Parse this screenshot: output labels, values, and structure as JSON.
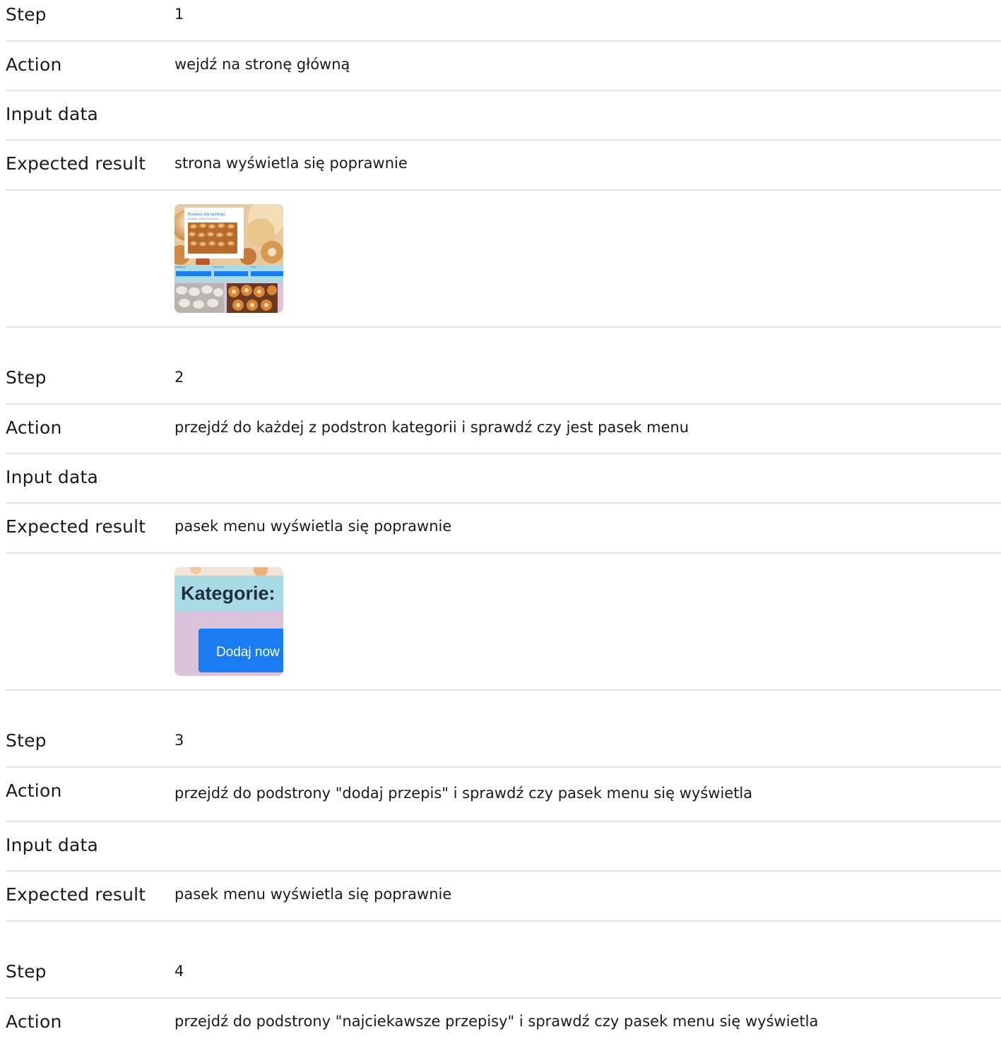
{
  "steps": [
    {
      "step_label": "Step",
      "step_value": "1",
      "action_label": "Action",
      "action_value": "wejdź na stronę główną",
      "input_label": "Input data",
      "input_value": "",
      "expected_label": "Expected result",
      "expected_value": "strona wyświetla się poprawnie",
      "screenshot": {
        "title": "Przepisy dla każdego.",
        "subtitle": "szybkie, łatwe i smaczne",
        "nav": [
          "Kategorie",
          "Smaczne",
          "Inne"
        ]
      }
    },
    {
      "step_label": "Step",
      "step_value": "2",
      "action_label": "Action",
      "action_value": "przejdź do każdej z podstron kategorii i sprawdź czy jest pasek menu",
      "input_label": "Input data",
      "input_value": "",
      "expected_label": "Expected result",
      "expected_value": "pasek menu wyświetla się poprawnie",
      "screenshot": {
        "heading": "Kategorie:",
        "button": "Dodaj now"
      }
    },
    {
      "step_label": "Step",
      "step_value": "3",
      "action_label": "Action",
      "action_value": "przejdź do podstrony \"dodaj przepis\" i sprawdź czy pasek menu się wyświetla",
      "input_label": "Input data",
      "input_value": "",
      "expected_label": "Expected result",
      "expected_value": "pasek menu wyświetla się poprawnie"
    },
    {
      "step_label": "Step",
      "step_value": "4",
      "action_label": "Action",
      "action_value": "przejdź do podstrony \"najciekawsze przepisy\" i sprawdź czy pasek menu się wyświetla"
    }
  ],
  "colors": {
    "divider": "#e3e3e3",
    "accent_blue": "#1a7cf2",
    "menu_cyan": "#a9dbe6",
    "page_lilac": "#dcc3dc"
  }
}
